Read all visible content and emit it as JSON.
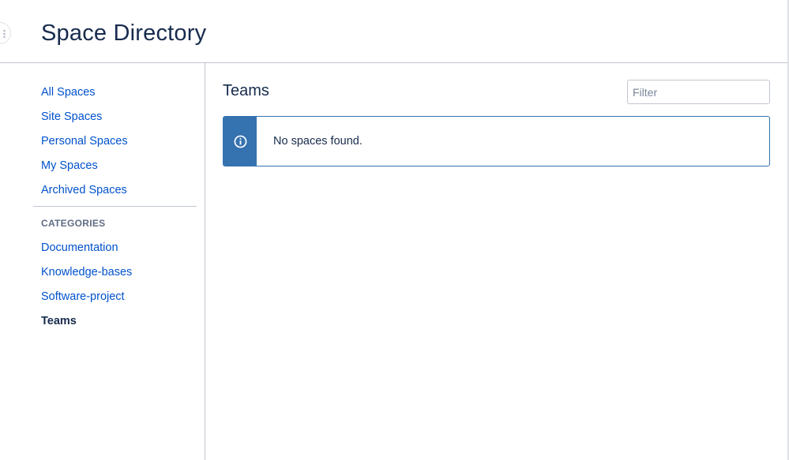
{
  "header": {
    "title": "Space Directory"
  },
  "sidebar": {
    "nav_items": [
      {
        "label": "All Spaces"
      },
      {
        "label": "Site Spaces"
      },
      {
        "label": "Personal Spaces"
      },
      {
        "label": "My Spaces"
      },
      {
        "label": "Archived Spaces"
      }
    ],
    "categories_heading": "CATEGORIES",
    "categories": [
      {
        "label": "Documentation"
      },
      {
        "label": "Knowledge-bases"
      },
      {
        "label": "Software-project"
      },
      {
        "label": "Teams",
        "active": true
      }
    ]
  },
  "main": {
    "section_title": "Teams",
    "filter": {
      "placeholder": "Filter",
      "value": ""
    },
    "message": {
      "icon": "info-icon",
      "text": "No spaces found."
    }
  },
  "colors": {
    "link": "#0052cc",
    "info_accent": "#3572b0",
    "text": "#172b4d",
    "border": "#c1c7d0"
  }
}
